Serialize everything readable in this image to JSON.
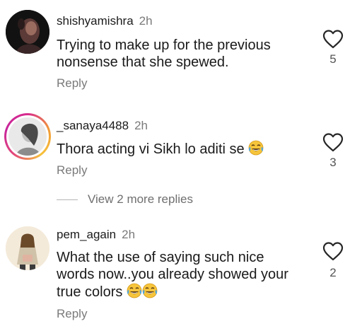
{
  "comments": [
    {
      "username": "shishyamishra",
      "time": "2h",
      "text_lines": [
        "Trying to make up for the previous",
        "nonsense that she spewed."
      ],
      "reply_label": "Reply",
      "likes": "5",
      "avatar": "dark-photo-avatar"
    },
    {
      "username": "_sanaya4488",
      "time": "2h",
      "text": "Thora acting vi Sikh lo aditi se",
      "emoji": "face-with-tears-of-joy",
      "reply_label": "Reply",
      "likes": "3",
      "avatar": "story-ring-avatar"
    },
    {
      "username": "pem_again",
      "time": "2h",
      "text_lines": [
        "What the use of saying such nice",
        "words now..you already showed your",
        "true colors"
      ],
      "emoji": "face-with-tears-of-joy",
      "reply_label": "Reply",
      "likes": "2",
      "avatar": "illustrated-avatar"
    }
  ],
  "view_replies_label": "View 2 more replies",
  "colors": {
    "text": "#1a1a1a",
    "muted": "#7a7a7a",
    "heart_outline": "#262626",
    "story_ring": "#d82c8d"
  }
}
